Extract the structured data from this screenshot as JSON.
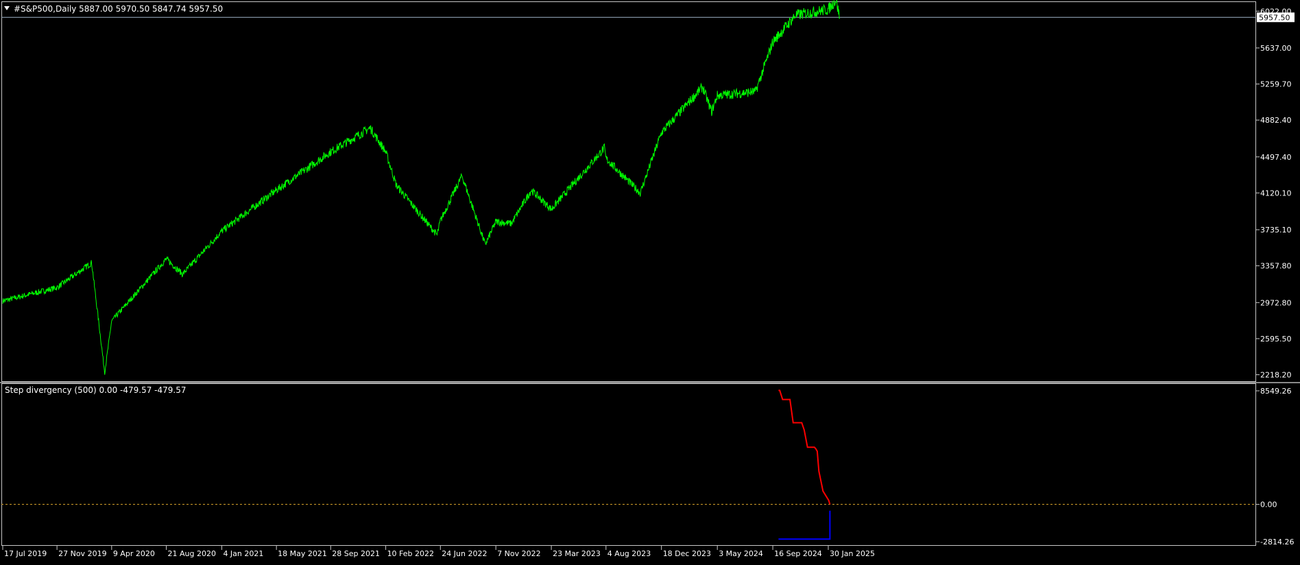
{
  "main_chart": {
    "header": "#S&P500,Daily  5887.00 5970.50 5847.74 5957.50",
    "current_price_label": "5957.50",
    "current_price": 5957.5,
    "line_color": "#00ff00",
    "price_ticks": [
      "6022.00",
      "5637.00",
      "5259.70",
      "4882.40",
      "4497.40",
      "4120.10",
      "3735.10",
      "3357.80",
      "2972.80",
      "2595.50",
      "2218.20"
    ],
    "chart_data": {
      "type": "line",
      "title": "#S&P500,Daily",
      "ylim": [
        2150,
        6110
      ],
      "x": [
        "17 Jul 2019",
        "27 Nov 2019",
        "20 Feb 2020",
        "23 Mar 2020",
        "9 Apr 2020",
        "21 Aug 2020",
        "30 Sep 2020",
        "4 Jan 2021",
        "18 May 2021",
        "28 Sep 2021",
        "3 Jan 2022",
        "10 Feb 2022",
        "8 Mar 2022",
        "16 Jun 2022",
        "24 Jun 2022",
        "16 Aug 2022",
        "12 Oct 2022",
        "7 Nov 2022",
        "15 Dec 2022",
        "2 Feb 2023",
        "23 Mar 2023",
        "31 Jul 2023",
        "4 Aug 2023",
        "27 Oct 2023",
        "18 Dec 2023",
        "28 Mar 2024",
        "19 Apr 2024",
        "3 May 2024",
        "5 Aug 2024",
        "16 Sep 2024",
        "11 Nov 2024",
        "30 Jan 2025",
        "18 Feb 2025",
        "27 Feb 2025"
      ],
      "values": [
        2990,
        3130,
        3390,
        2240,
        2780,
        3430,
        3270,
        3720,
        4150,
        4550,
        4800,
        4550,
        4200,
        3680,
        3830,
        4300,
        3580,
        3820,
        3800,
        4150,
        3950,
        4590,
        4480,
        4120,
        4750,
        5230,
        4970,
        5140,
        5180,
        5700,
        5980,
        6040,
        6140,
        5957.5
      ]
    }
  },
  "indicator": {
    "header": "Step divergency (500) 0.00 -479.57 -479.57",
    "ticks": [
      "8549.26",
      "0.00",
      "-2814.26"
    ],
    "zero_line_color": "#d4a02a",
    "chart_data": {
      "type": "line",
      "title": "Step divergency (500)",
      "ylim": [
        -2814.26,
        8549.26
      ],
      "series": [
        {
          "color": "#ff0000",
          "x": [
            "30 Sep 2024",
            "3 Oct 2024",
            "10 Oct 2024",
            "28 Oct 2024",
            "5 Nov 2024",
            "26 Nov 2024",
            "2 Dec 2024",
            "10 Dec 2024",
            "20 Dec 2024",
            "27 Dec 2024",
            "30 Dec 2024",
            "3 Jan 2025",
            "7 Jan 2025",
            "17 Jan 2025",
            "31 Jan 2025",
            "3 Feb 2025"
          ],
          "values": [
            8580,
            8580,
            7900,
            7900,
            6150,
            6150,
            5600,
            4300,
            4300,
            4300,
            4200,
            4000,
            2500,
            1000,
            300,
            0
          ]
        },
        {
          "color": "#0000ff",
          "x": [
            "30 Sep 2024",
            "16 Jan 2025",
            "3 Feb 2025",
            "3 Feb 2025"
          ],
          "values": [
            -2620,
            -2620,
            -2620,
            -479.57
          ]
        }
      ]
    }
  },
  "time_axis": {
    "labels": [
      "17 Jul 2019",
      "27 Nov 2019",
      "9 Apr 2020",
      "21 Aug 2020",
      "4 Jan 2021",
      "18 May 2021",
      "28 Sep 2021",
      "10 Feb 2022",
      "24 Jun 2022",
      "7 Nov 2022",
      "23 Mar 2023",
      "4 Aug 2023",
      "18 Dec 2023",
      "3 May 2024",
      "16 Sep 2024",
      "30 Jan 2025"
    ]
  }
}
